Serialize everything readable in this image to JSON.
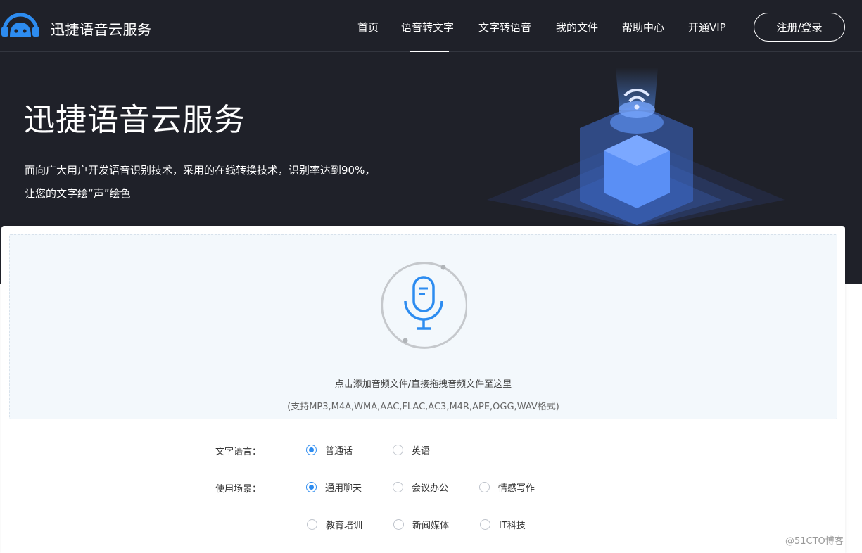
{
  "colors": {
    "hero_bg": "#1f2129",
    "accent": "#2d8cf0",
    "drop_bg": "#f3f8fc"
  },
  "header": {
    "brand": "迅捷语音云服务",
    "nav": [
      "首页",
      "语音转文字",
      "文字转语音",
      "我的文件",
      "帮助中心",
      "开通VIP"
    ],
    "active_nav": "语音转文字",
    "login_label": "注册/登录"
  },
  "hero": {
    "title": "迅捷语音云服务",
    "description": "面向广大用户开发语音识别技术，采用的在线转换技术，识别率达到90%，让您的文字绘“声”绘色"
  },
  "upload": {
    "icon": "microphone-icon",
    "prompt": "点击添加音频文件/直接拖拽音频文件至这里",
    "formats": "(支持MP3,M4A,WMA,AAC,FLAC,AC3,M4R,APE,OGG,WAV格式)"
  },
  "options": {
    "language": {
      "label": "文字语言：",
      "choices": [
        "普通话",
        "英语"
      ],
      "selected": "普通话"
    },
    "scenario": {
      "label": "使用场景：",
      "choices": [
        "通用聊天",
        "会议办公",
        "情感写作",
        "教育培训",
        "新闻媒体",
        "IT科技"
      ],
      "selected": "通用聊天"
    }
  },
  "watermark": "@51CTO博客"
}
